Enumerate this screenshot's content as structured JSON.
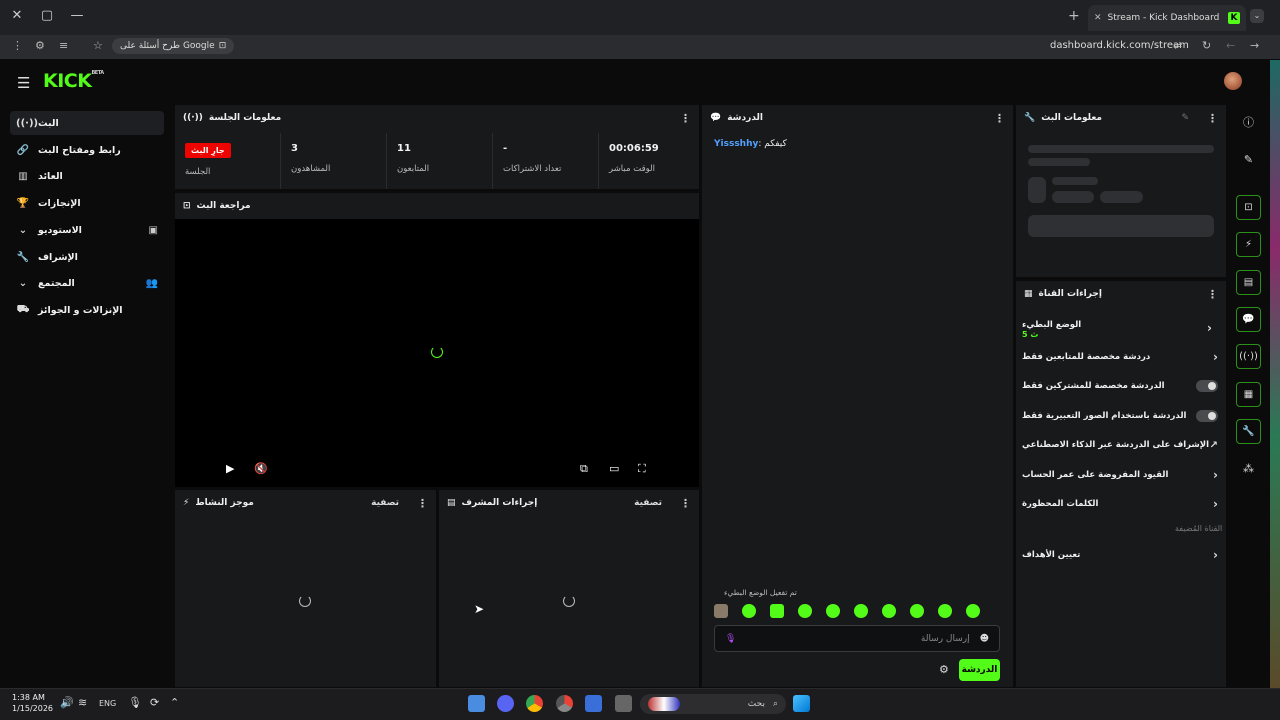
{
  "browser": {
    "tab_title": "Stream - Kick Dashboard",
    "tab_favicon": "K",
    "url": "dashboard.kick.com/stream",
    "chip_label": "طرح أسئلة على Google",
    "new_tab": "+",
    "close": "✕",
    "win_close": "✕",
    "win_max": "▢",
    "win_min": "—"
  },
  "brand": {
    "logo": "KICK",
    "beta": "BETA",
    "accent": "#53fc18"
  },
  "sidebar": {
    "items": [
      {
        "label": "البث",
        "icon": "((·))"
      },
      {
        "label": "رابط ومفتاح البث",
        "icon": "🔗"
      },
      {
        "label": "العائد",
        "icon": "▥"
      },
      {
        "label": "الإنجازات",
        "icon": "🏆"
      },
      {
        "label": "الاستوديو",
        "icon": "▣",
        "chevron": "⌄"
      },
      {
        "label": "الإشراف",
        "icon": "🔧"
      },
      {
        "label": "المجتمع",
        "icon": "👥",
        "chevron": "⌄"
      },
      {
        "label": "الإنزالات و الجوائز",
        "icon": "⛟"
      }
    ]
  },
  "session": {
    "title": "معلومات الجلسة",
    "live_badge": "جارِ البث",
    "live_label": "الجلسة",
    "stats": [
      {
        "value": "3",
        "label": "المشاهدون"
      },
      {
        "value": "11",
        "label": "المتابعون"
      },
      {
        "value": "-",
        "label": "تعداد الاشتراكات"
      },
      {
        "value": "00:06:59",
        "label": "الوقت مباشر"
      }
    ]
  },
  "preview": {
    "title": "مراجعة البث"
  },
  "activity": {
    "title": "موجز النشاط",
    "filter": "تصفية"
  },
  "modactions": {
    "title": "إجراءات المشرف",
    "filter": "تصفية"
  },
  "chat": {
    "title": "الدردشة",
    "messages": [
      {
        "user": "Yissshhy",
        "text": "كيفكم"
      }
    ],
    "slow_note": "تم تفعيل الوضع البطيء",
    "placeholder": "إرسال رسالة",
    "send_label": "الدردشة"
  },
  "streaminfo": {
    "title": "معلومات البث"
  },
  "channel_actions": {
    "title": "إجراءات القناة",
    "slow_mode": "الوضع البطيء",
    "slow_value": "5 ث",
    "followers_only": "دردشة مخصصة للمتابعين فقط",
    "subs_only": "الدردشة مخصصة للمشتركين فقط",
    "emotes_only": "الدردشة باستخدام الصور التعبيرية فقط",
    "ai_moderation": "الإشراف على الدردشة عبر الذكاء الاصطناعي",
    "account_age": "القيود المفروضة على عمر الحساب",
    "banned_words": "الكلمات المحظورة",
    "host_channel": "القناة المُضيفة",
    "goals": "تعيين الأهداف"
  },
  "taskbar": {
    "time": "1:38 AM",
    "date": "1/15/2026",
    "lang": "ENG",
    "search_placeholder": "بحث"
  }
}
